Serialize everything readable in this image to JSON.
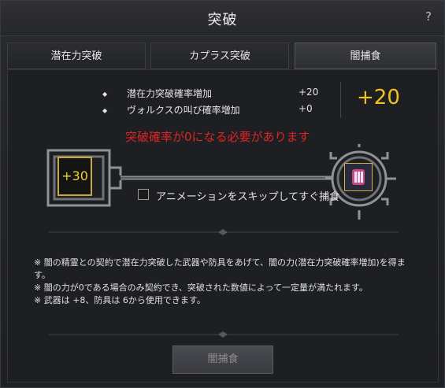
{
  "window": {
    "title": "突破",
    "help_label": "?"
  },
  "tabs": [
    {
      "label": "潜在力突破"
    },
    {
      "label": "カプラス突破"
    },
    {
      "label": "闇捕食"
    }
  ],
  "bonuses": [
    {
      "name": "潜在力突破確率増加",
      "value": "+20"
    },
    {
      "name": "ヴォルクスの叫び確率増加",
      "value": "+0"
    }
  ],
  "bullet": "◆",
  "total": "+20",
  "warning": "突破確率が0になる必要があります",
  "current_value": "+30",
  "skip_label": "アニメーションをスキップしてすぐ捕食",
  "notes": [
    "※ 闇の精霊との契約で潜在力突破した武器や防具をあげて、闇の力(潜在力突破確率増加)を得ます。",
    "※ 闇の力が0である場合のみ契約でき、突破された数値によって一定量が満たれます。",
    "※ 武器は +8、防具は 6から使用できます。"
  ],
  "action_button": "闇捕食",
  "colors": {
    "accent": "#f3c21f",
    "warning": "#e02424",
    "frame": "#caa93a"
  },
  "icons": {
    "item": "armor-item-icon",
    "ornament": "ornate-key-frame"
  }
}
